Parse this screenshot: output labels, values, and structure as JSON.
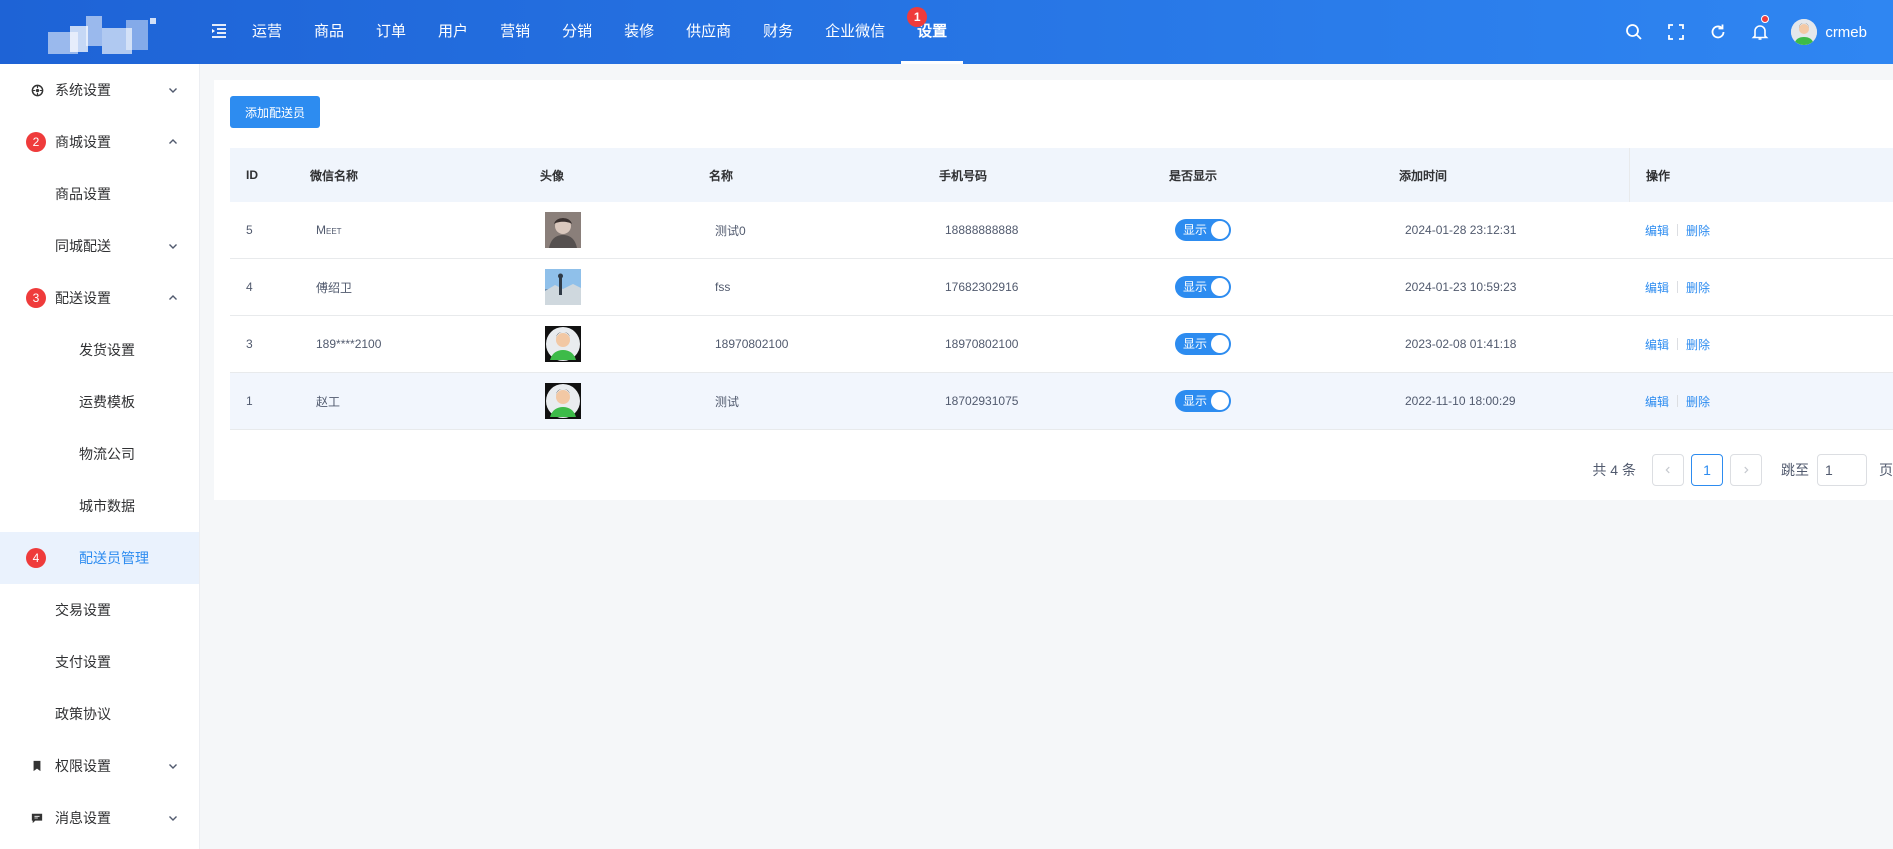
{
  "header": {
    "nav": [
      {
        "label": "运营"
      },
      {
        "label": "商品"
      },
      {
        "label": "订单"
      },
      {
        "label": "用户"
      },
      {
        "label": "营销"
      },
      {
        "label": "分销"
      },
      {
        "label": "装修"
      },
      {
        "label": "供应商"
      },
      {
        "label": "财务"
      },
      {
        "label": "企业微信"
      },
      {
        "label": "设置",
        "badge": "1"
      }
    ],
    "user_name": "crmeb"
  },
  "sidebar": {
    "items": [
      {
        "label": "系统设置",
        "icon": "gear-icon"
      },
      {
        "label": "商城设置",
        "badge": "2"
      },
      {
        "label": "商品设置"
      },
      {
        "label": "同城配送"
      },
      {
        "label": "配送设置",
        "badge": "3"
      },
      {
        "label": "发货设置"
      },
      {
        "label": "运费模板"
      },
      {
        "label": "物流公司"
      },
      {
        "label": "城市数据"
      },
      {
        "label": "配送员管理",
        "badge": "4"
      },
      {
        "label": "交易设置"
      },
      {
        "label": "支付设置"
      },
      {
        "label": "政策协议"
      },
      {
        "label": "权限设置",
        "icon": "bookmark-icon"
      },
      {
        "label": "消息设置",
        "icon": "message-icon"
      }
    ]
  },
  "toolbar": {
    "add_label": "添加配送员"
  },
  "table": {
    "headers": [
      "ID",
      "微信名称",
      "头像",
      "名称",
      "手机号码",
      "是否显示",
      "添加时间",
      "操作"
    ],
    "rows": [
      {
        "id": "5",
        "wechat": "Meet",
        "name": "测试0",
        "phone": "18888888888",
        "show": "显示",
        "time": "2024-01-28 23:12:31"
      },
      {
        "id": "4",
        "wechat": "傅绍卫",
        "name": "fss",
        "phone": "17682302916",
        "show": "显示",
        "time": "2024-01-23 10:59:23"
      },
      {
        "id": "3",
        "wechat": "189****2100",
        "name": "18970802100",
        "phone": "18970802100",
        "show": "显示",
        "time": "2023-02-08 01:41:18"
      },
      {
        "id": "1",
        "wechat": "赵工",
        "name": "测试",
        "phone": "18702931075",
        "show": "显示",
        "time": "2022-11-10 18:00:29"
      }
    ],
    "edit_label": "编辑",
    "delete_label": "删除"
  },
  "pager": {
    "total": "共 4 条",
    "current": "1",
    "jump_label": "跳至",
    "jump_value": "1",
    "suffix": "页"
  },
  "colors": {
    "primary": "#2d8cf0",
    "header_start": "#1e63d6",
    "header_end": "#2f86f2",
    "badge": "#ef3b3b"
  }
}
